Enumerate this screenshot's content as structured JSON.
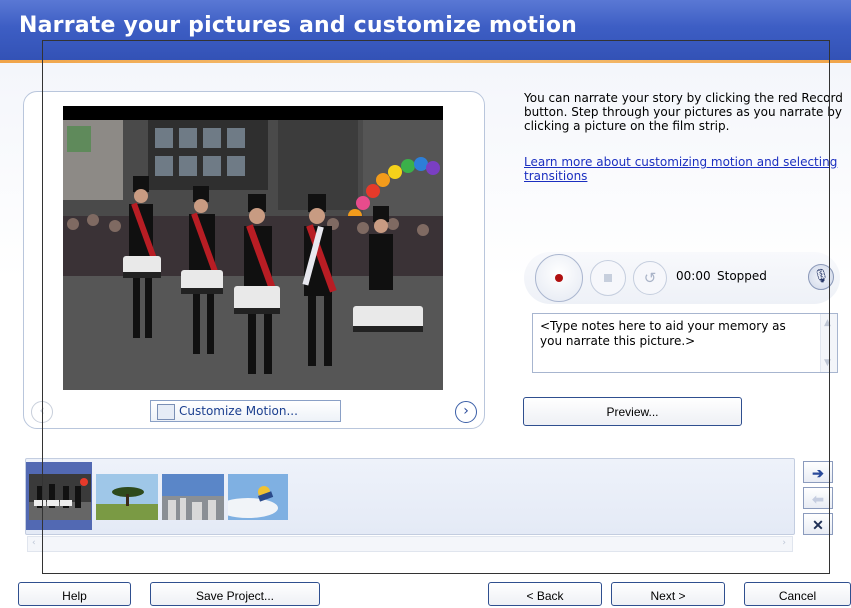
{
  "title": "Narrate your pictures and customize motion",
  "description": "You can narrate your story by clicking the red Record button. Step through your pictures as you narrate by clicking a picture on the film strip.",
  "help_link": "Learn more about customizing motion and selecting transitions",
  "preview": {
    "customize_label": "Customize Motion...",
    "prev_icon": "‹",
    "next_icon": "›"
  },
  "recorder": {
    "time": "00:00",
    "status": "Stopped",
    "undo_icon": "↺",
    "mic_icon": "🎙"
  },
  "notes": {
    "text": "<Type notes here to aid your memory as you narrate this picture.>"
  },
  "preview_button": "Preview...",
  "filmstrip": {
    "side_buttons": {
      "next": "➔",
      "prev": "⬅",
      "delete": "✕"
    },
    "scroll_left": "‹",
    "scroll_right": "›"
  },
  "footer": {
    "help": "Help",
    "save": "Save Project...",
    "back": "< Back",
    "next": "Next >",
    "cancel": "Cancel"
  },
  "colors": {
    "title_bar": "#3d5ec4",
    "accent_line": "#f0a44a",
    "link": "#1b2fc0",
    "record": "#b01010",
    "film_selected": "#5269b3"
  }
}
